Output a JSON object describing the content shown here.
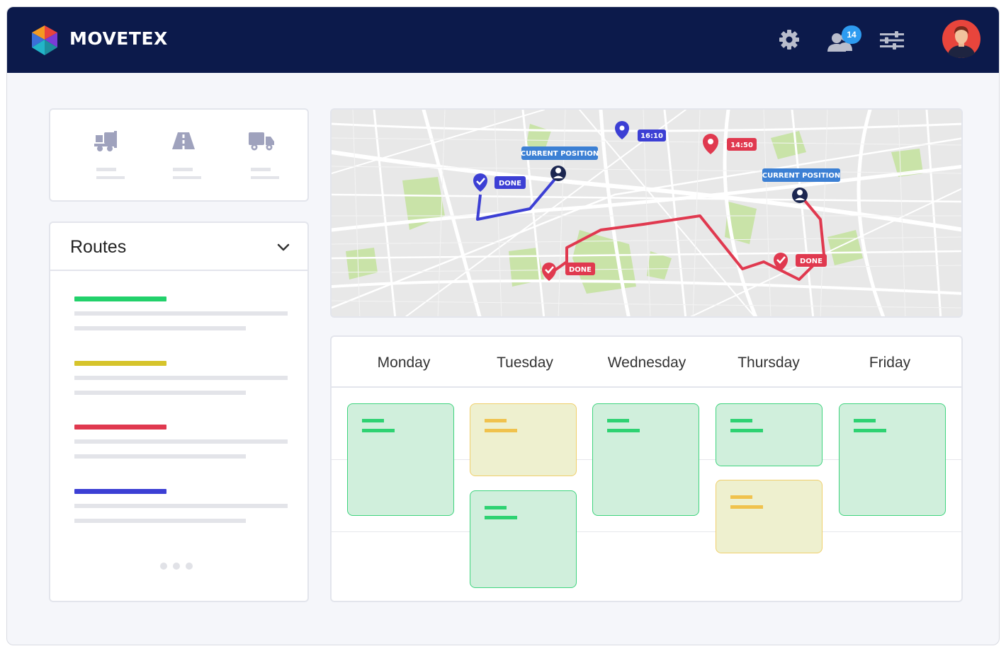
{
  "app": {
    "brand": "MOVETEX",
    "notifications_count": "14"
  },
  "colors": {
    "navbar": "#0c1a4b",
    "route_green": "#22d16b",
    "route_yellow": "#d6c42c",
    "route_red": "#e0394f",
    "route_blue": "#3c3fd4",
    "badge_blue": "#2e9bf0",
    "event_green": "#d0efdc",
    "event_yellow": "#eef0cf"
  },
  "quick_icons": [
    "forklift-icon",
    "road-icon",
    "truck-icon"
  ],
  "routes": {
    "title": "Routes",
    "items": [
      {
        "color": "#22d16b"
      },
      {
        "color": "#d6c42c"
      },
      {
        "color": "#e0394f"
      },
      {
        "color": "#3c3fd4"
      }
    ]
  },
  "map": {
    "labels": {
      "done_blue": "DONE",
      "current_blue": "CURRENT POSITION",
      "time_blue": "16:10",
      "time_red": "14:50",
      "current_red": "CURRENT POSITION",
      "done_red_left": "DONE",
      "done_red_right": "DONE"
    }
  },
  "calendar": {
    "days": [
      "Monday",
      "Tuesday",
      "Wednesday",
      "Thursday",
      "Friday"
    ],
    "events": [
      {
        "day": "Monday",
        "color": "green"
      },
      {
        "day": "Tuesday",
        "color": "yellow"
      },
      {
        "day": "Tuesday",
        "color": "green"
      },
      {
        "day": "Wednesday",
        "color": "green"
      },
      {
        "day": "Thursday",
        "color": "green"
      },
      {
        "day": "Thursday",
        "color": "yellow"
      },
      {
        "day": "Friday",
        "color": "green"
      }
    ]
  }
}
